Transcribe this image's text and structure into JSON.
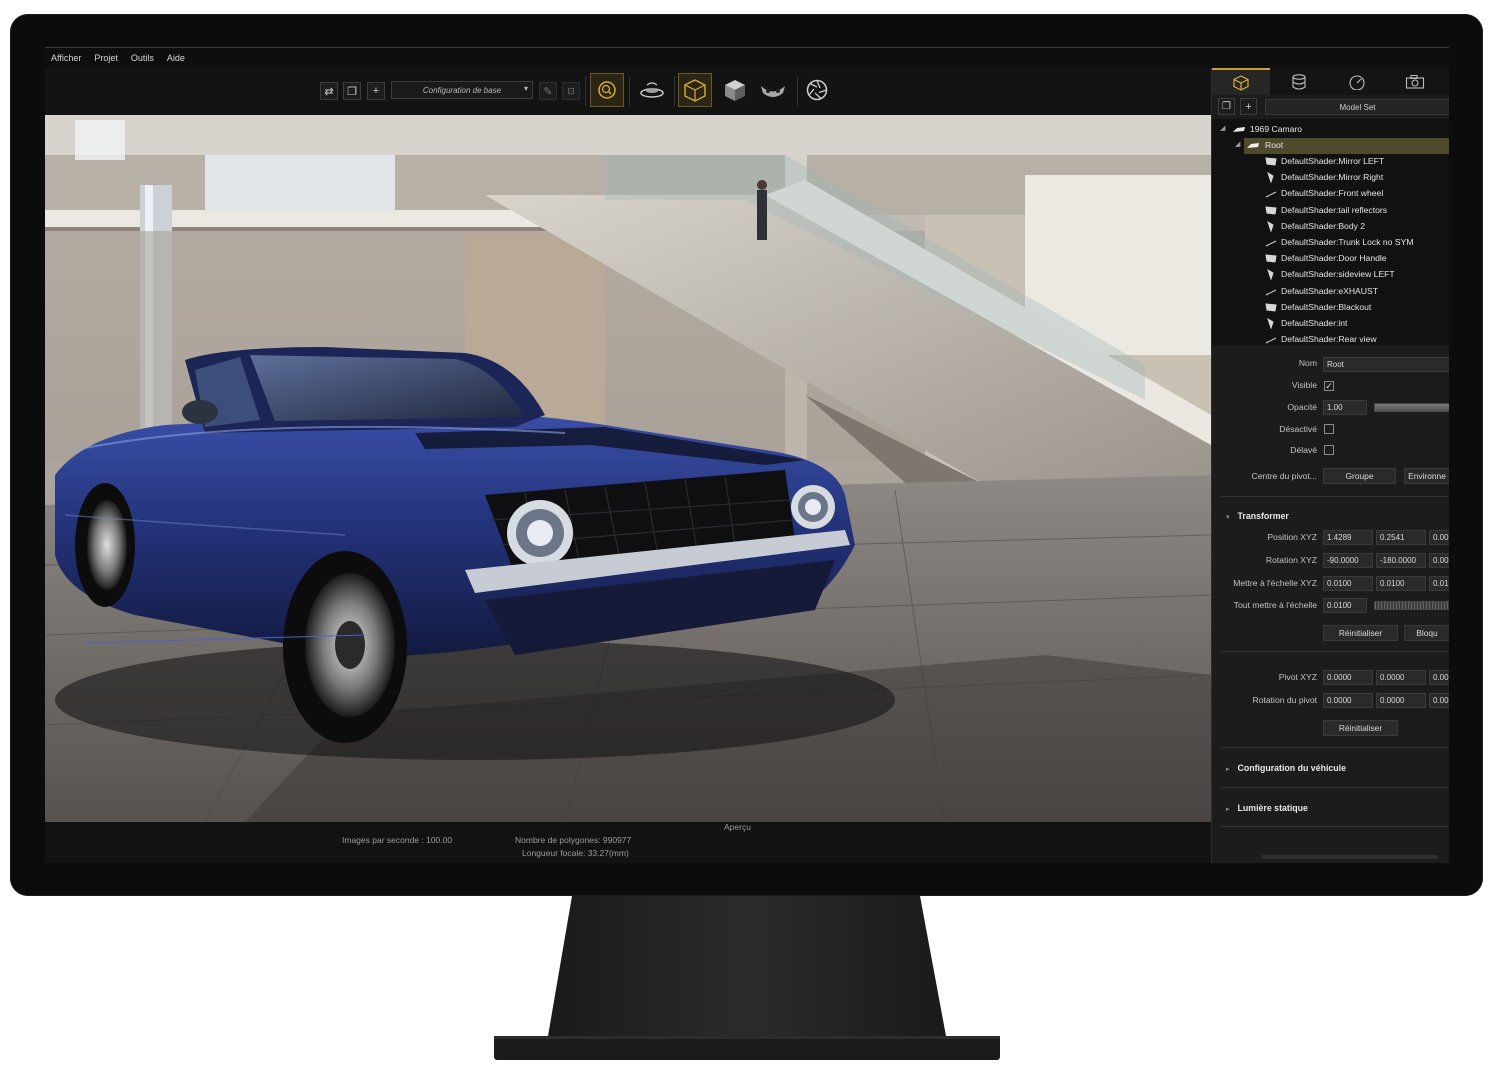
{
  "menu": {
    "items": [
      "Afficher",
      "Projet",
      "Outils",
      "Aide"
    ]
  },
  "toolbar": {
    "configuration_select": "Configuration de base",
    "icons": [
      "swap-icon",
      "duplicate-icon",
      "add-icon",
      "edit-icon",
      "lock-icon",
      "search-zoom-icon",
      "turntable-icon",
      "object-box-icon",
      "shaded-cube-icon",
      "mask-icon",
      "aperture-icon"
    ]
  },
  "viewport": {
    "caption": "Aperçu"
  },
  "status": {
    "fps": "Images par seconde : 100.00",
    "polygons": "Nombre de polygones: 990977",
    "focal": "Longueur focale: 33.27(mm)"
  },
  "panel": {
    "tabs": [
      "cube-icon",
      "database-icon",
      "gauge-icon",
      "camera-icon"
    ],
    "model_set": "Model Set",
    "tree": {
      "root_model": "1969 Camaro",
      "root_node": "Root",
      "children": [
        "DefaultShader:Mirror LEFT",
        "DefaultShader:Mirror Right",
        "DefaultShader:Front wheel",
        "DefaultShader:tail reflectors",
        "DefaultShader:Body 2",
        "DefaultShader:Trunk Lock no SYM",
        "DefaultShader:Door Handle",
        "DefaultShader:sideview LEFT",
        "DefaultShader:eXHAUST",
        "DefaultShader:Blackout",
        "DefaultShader:int",
        "DefaultShader:Rear view"
      ]
    },
    "props": {
      "nom_label": "Nom",
      "nom_value": "Root",
      "visible_label": "Visible",
      "visible_checked": true,
      "opacity_label": "Opacité",
      "opacity_value": "1.00",
      "opacity_level": 1.0,
      "desactive_label": "Désactivé",
      "desactive_checked": false,
      "delave_label": "Délavé",
      "delave_checked": false,
      "pivot_center_label": "Centre du pivot...",
      "groupe_button": "Groupe",
      "environ_button": "Environne",
      "transform_section": "Transformer",
      "position_label": "Position XYZ",
      "position": [
        "1.4289",
        "0.2541",
        "0.00"
      ],
      "rotation_label": "Rotation XYZ",
      "rotation": [
        "-90.0000",
        "-180.0000",
        "0.00"
      ],
      "scale_label": "Mettre à l'échelle XYZ",
      "scale": [
        "0.0100",
        "0.0100",
        "0.01"
      ],
      "scale_all_label": "Tout mettre à l'échelle",
      "scale_all": "0.0100",
      "reset_button": "Réinitialiser",
      "lock_button": "Bloqu",
      "pivot_label": "Pivot XYZ",
      "pivot": [
        "0.0000",
        "0.0000",
        "0.00"
      ],
      "pivot_rot_label": "Rotation du pivot",
      "pivot_rot": [
        "0.0000",
        "0.0000",
        "0.00"
      ],
      "reset_button_2": "Réinitialiser",
      "vehicle_section": "Configuration du véhicule",
      "static_light_section": "Lumière statique"
    }
  },
  "colors": {
    "accent": "#c9a13a",
    "selection": "#4f4a2c",
    "car_body": "#23306e"
  }
}
